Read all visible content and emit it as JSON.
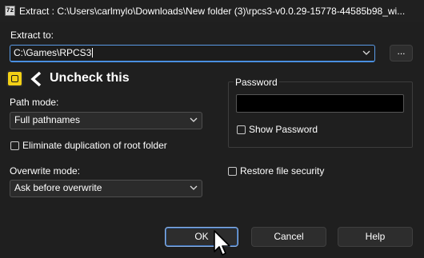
{
  "window": {
    "app_icon_text": "7z",
    "title": "Extract : C:\\Users\\carlmylo\\Downloads\\New folder (3)\\rpcs3-v0.0.29-15778-44585b98_wi..."
  },
  "extract_to": {
    "label": "Extract to:",
    "value": "C:\\Games\\RPCS3",
    "browse_label": "..."
  },
  "annotation": {
    "text": "Uncheck this",
    "color": "#f2d016"
  },
  "path_mode": {
    "label": "Path mode:",
    "value": "Full pathnames"
  },
  "eliminate_duplication": {
    "label": "Eliminate duplication of root folder",
    "checked": false
  },
  "overwrite_mode": {
    "label": "Overwrite mode:",
    "value": "Ask before overwrite"
  },
  "password": {
    "group_label": "Password",
    "value": "",
    "show_password_label": "Show Password",
    "show_password_checked": false
  },
  "restore_security": {
    "label": "Restore file security",
    "checked": false
  },
  "buttons": {
    "ok": "OK",
    "cancel": "Cancel",
    "help": "Help"
  },
  "colors": {
    "accent": "#4a8fe0",
    "background": "#1f1f1f"
  }
}
